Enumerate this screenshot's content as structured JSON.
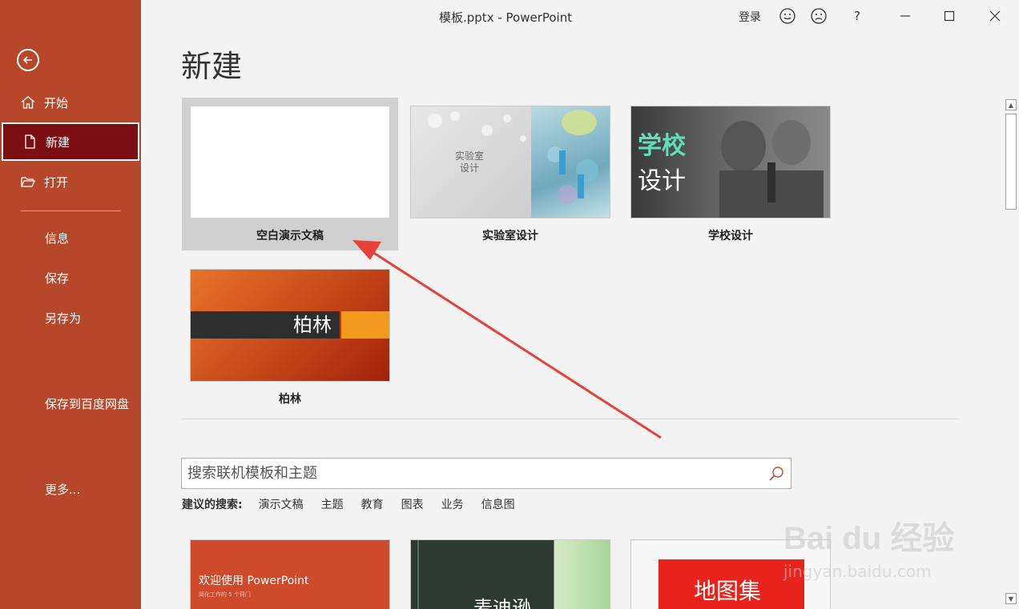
{
  "window": {
    "title": "模板.pptx - PowerPoint",
    "login_label": "登录",
    "help_label": "?"
  },
  "sidebar": {
    "items": [
      {
        "label": "开始",
        "icon": "home-icon"
      },
      {
        "label": "新建",
        "icon": "new-document-icon",
        "active": true
      },
      {
        "label": "打开",
        "icon": "folder-open-icon"
      },
      {
        "label": "信息"
      },
      {
        "label": "保存"
      },
      {
        "label": "另存为"
      },
      {
        "label": "保存到百度网盘"
      },
      {
        "label": "更多..."
      }
    ]
  },
  "main": {
    "title": "新建",
    "templates": [
      {
        "label": "空白演示文稿",
        "selected": true
      },
      {
        "label": "实验室设计",
        "thumb_text": [
          "实验室",
          "设计"
        ]
      },
      {
        "label": "学校设计",
        "thumb_text": [
          "学校",
          "设计"
        ]
      },
      {
        "label": "柏林",
        "thumb_text": "柏林"
      }
    ],
    "search": {
      "placeholder": "搜索联机模板和主题"
    },
    "suggestions": {
      "lead": "建议的搜索:",
      "items": [
        "演示文稿",
        "主题",
        "教育",
        "图表",
        "业务",
        "信息图"
      ]
    },
    "featured": [
      {
        "title": "欢迎使用 PowerPoint",
        "subtitle": "简化工作的 5 个窍门"
      },
      {
        "title": "麦迪逊"
      },
      {
        "title": "地图集"
      }
    ]
  },
  "watermark": {
    "brand": "Bai du 经验",
    "url": "jingyan.baidu.com"
  },
  "colors": {
    "sidebar": "#b7472a",
    "sidebar_active": "#7b0f14",
    "background": "#f3f3f3",
    "annotation_arrow": "#e8413a"
  }
}
